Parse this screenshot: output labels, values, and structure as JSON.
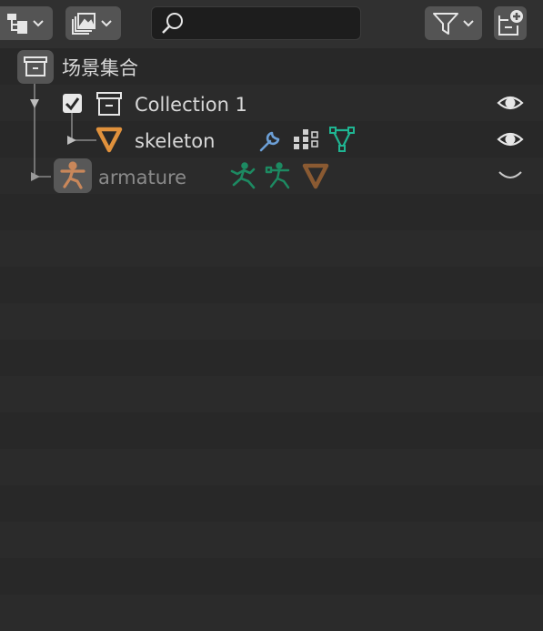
{
  "header": {
    "display_mode_icon": "outliner-tree-icon",
    "filter_icon": "funnel-icon",
    "new_collection_icon": "new-collection-icon",
    "search": {
      "value": "",
      "placeholder": ""
    }
  },
  "outliner": {
    "scene_collection": {
      "label": "场景集合",
      "icon": "collection-box-icon"
    },
    "collection": {
      "label": "Collection 1",
      "checked": true,
      "icon": "collection-box-icon"
    },
    "skeleton": {
      "label": "skeleton",
      "icon": "mesh-object-icon",
      "extras": [
        "wrench-modifier-icon",
        "vertex-groups-icon",
        "mesh-data-icon"
      ]
    },
    "armature": {
      "label": "armature",
      "icon": "armature-object-icon",
      "extras": [
        "pose-icon",
        "armature-data-icon",
        "mesh-object-icon"
      ]
    }
  },
  "colors": {
    "background": "#282828",
    "header": "#303030",
    "mesh_orange": "#e0913c",
    "armature_green": "#1fb592",
    "wrench_blue": "#6c9fd6"
  }
}
